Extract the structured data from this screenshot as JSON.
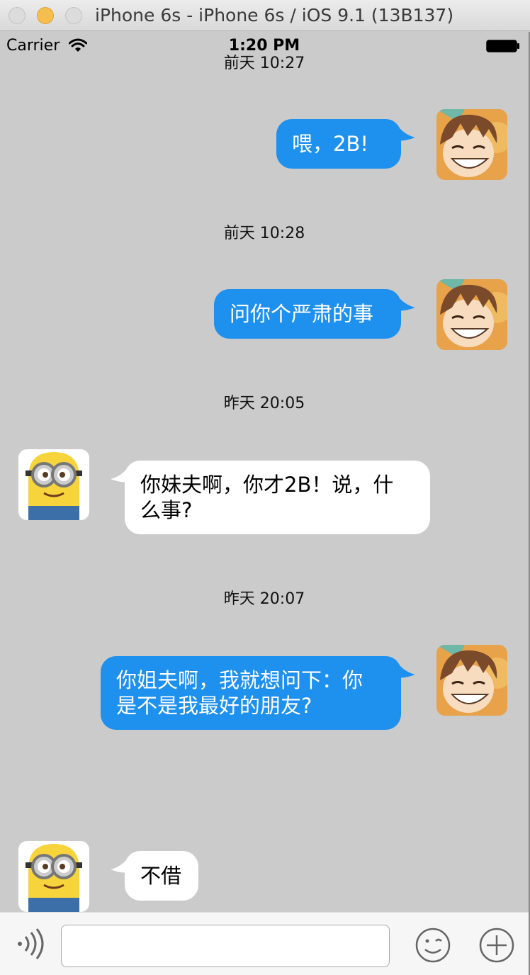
{
  "window": {
    "title": "iPhone 6s - iPhone 6s / iOS 9.1 (13B137)"
  },
  "status_bar": {
    "carrier": "Carrier",
    "time": "1:20 PM"
  },
  "messages": [
    {
      "timestamp": "前天 10:27",
      "sender": "me",
      "lines": [
        "喂，2B!"
      ]
    },
    {
      "timestamp": "前天 10:28",
      "sender": "me",
      "lines": [
        "问你个严肃的事"
      ]
    },
    {
      "timestamp": "昨天 20:05",
      "sender": "other",
      "lines": [
        "你妹夫啊，你才2B！说，什",
        "么事?"
      ]
    },
    {
      "timestamp": "昨天 20:07",
      "sender": "me",
      "lines": [
        "你姐夫啊，我就想问下：你",
        "是不是我最好的朋友?"
      ]
    },
    {
      "sender": "other",
      "lines": [
        "不借"
      ]
    }
  ],
  "input_bar": {
    "message_value": "",
    "icons": [
      "voice-icon",
      "emoji-icon",
      "plus-icon"
    ]
  },
  "colors": {
    "my_bubble": "#1e90ee",
    "other_bubble": "#ffffff",
    "background": "#cbcbcb"
  }
}
